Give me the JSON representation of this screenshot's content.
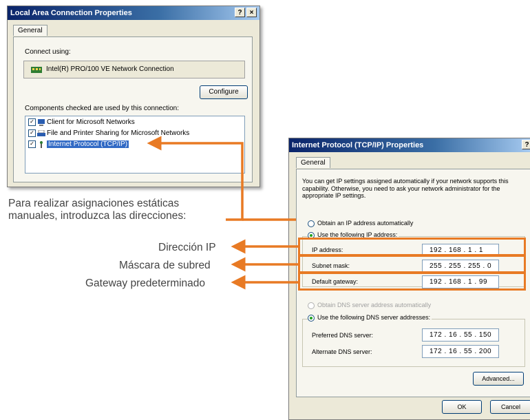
{
  "lac_window": {
    "title": "Local Area Connection Properties",
    "help_button": "?",
    "close_button": "×",
    "tab": "General",
    "connect_using_label": "Connect using:",
    "adapter": "Intel(R) PRO/100 VE Network Connection",
    "configure_button": "Configure",
    "components_label": "Components checked are used by this connection:",
    "components": [
      {
        "label": "Client for Microsoft Networks",
        "checked": true,
        "icon": "network-client-icon"
      },
      {
        "label": "File and Printer Sharing for Microsoft Networks",
        "checked": true,
        "icon": "printer-share-icon"
      },
      {
        "label": "Internet Protocol (TCP/IP)",
        "checked": true,
        "icon": "protocol-icon",
        "selected": true
      }
    ]
  },
  "tcpip_window": {
    "title": "Internet Protocol (TCP/IP) Properties",
    "help_button": "?",
    "tab": "General",
    "description": "You can get IP settings assigned automatically if your network supports this capability. Otherwise, you need to ask your network administrator for the appropriate IP settings.",
    "obtain_ip_auto": "Obtain an IP address automatically",
    "use_following_ip": "Use the following IP address:",
    "ip_label": "IP address:",
    "ip_value": "192 . 168 .  1  .  1",
    "subnet_label": "Subnet mask:",
    "subnet_value": "255 . 255 . 255 .  0",
    "gateway_label": "Default gateway:",
    "gateway_value": "192 . 168 .  1  . 99",
    "obtain_dns_auto": "Obtain DNS server address automatically",
    "use_following_dns": "Use the following DNS server addresses:",
    "preferred_dns_label": "Preferred DNS server:",
    "preferred_dns_value": "172 .  16 .  55 . 150",
    "alternate_dns_label": "Alternate DNS server:",
    "alternate_dns_value": "172 .  16 .  55 . 200",
    "advanced_button": "Advanced...",
    "ok_button": "OK",
    "cancel_button": "Cancel"
  },
  "annotations": {
    "intro_line1": "Para realizar asignaciones estáticas",
    "intro_line2": "manuales, introduzca las direcciones:",
    "ip_caption": "Dirección IP",
    "subnet_caption": "Máscara de subred",
    "gateway_caption": "Gateway predeterminado",
    "arrow_color": "#e87a24"
  }
}
